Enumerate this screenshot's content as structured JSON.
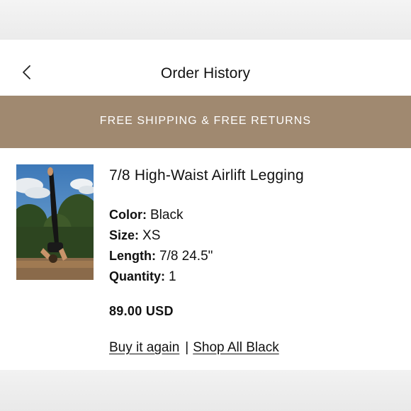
{
  "header": {
    "back_icon": "chevron-left-icon",
    "title": "Order History"
  },
  "banner": {
    "text": "FREE SHIPPING & FREE RETURNS",
    "color": "#a08970"
  },
  "product": {
    "image_icon": "product-photo",
    "name": "7/8 High-Waist Airlift Legging",
    "attributes": [
      {
        "label": "Color:",
        "value": "Black"
      },
      {
        "label": "Size:",
        "value": "XS"
      },
      {
        "label": "Length:",
        "value": "7/8 24.5\""
      },
      {
        "label": "Quantity:",
        "value": "1"
      }
    ],
    "price": "89.00 USD",
    "actions": {
      "buy_again": "Buy it again",
      "separator": "|",
      "shop_all": "Shop All Black"
    }
  }
}
